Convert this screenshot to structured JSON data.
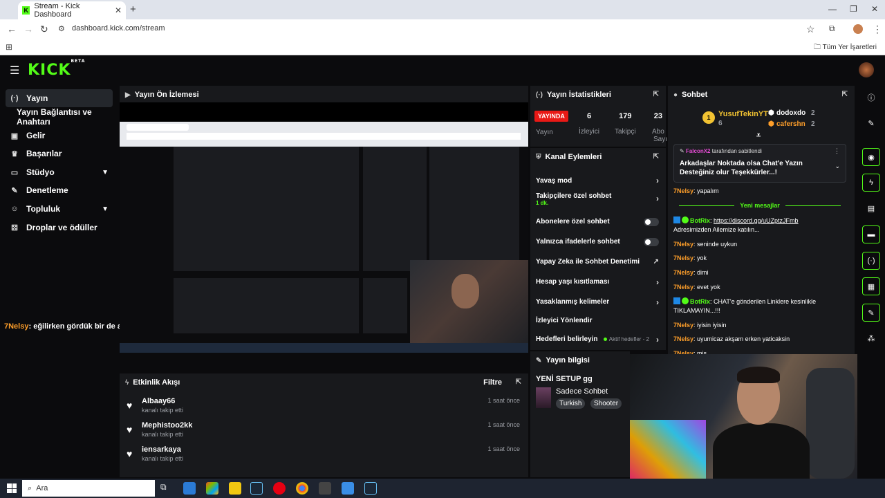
{
  "browser": {
    "tab_title": "Stream - Kick Dashboard",
    "url": "dashboard.kick.com/stream",
    "bookmarks_label": "Tüm Yer İşaretleri"
  },
  "kick": {
    "logo": "KICK",
    "beta": "BETA"
  },
  "sidebar": {
    "items": [
      {
        "label": "Yayın",
        "icon": "broadcast-icon"
      },
      {
        "label": "Yayın Bağlantısı ve Anahtarı"
      },
      {
        "label": "Gelir",
        "icon": "money-icon"
      },
      {
        "label": "Başarılar",
        "icon": "trophy-icon"
      },
      {
        "label": "Stüdyo",
        "icon": "monitor-icon"
      },
      {
        "label": "Denetleme",
        "icon": "wrench-icon"
      },
      {
        "label": "Topluluk",
        "icon": "people-icon"
      },
      {
        "label": "Droplar ve ödüller",
        "icon": "gift-icon"
      }
    ]
  },
  "overlay_chat": {
    "user": "7Nelsy",
    "text": ": eğilirken gördük bir de abo"
  },
  "preview": {
    "title": "Yayın Ön İzlemesi"
  },
  "events": {
    "title": "Etkinlik Akışı",
    "filter": "Filtre",
    "rows": [
      {
        "name": "Albaay66",
        "sub": "kanalı takip etti",
        "time": "1 saat önce"
      },
      {
        "name": "Mephistoo2kk",
        "sub": "kanalı takip etti",
        "time": "1 saat önce"
      },
      {
        "name": "iensarkaya",
        "sub": "kanalı takip etti",
        "time": "1 saat önce"
      }
    ]
  },
  "stats": {
    "title": "Yayın İstatistikleri",
    "live": "YAYINDA",
    "live_label": "Yayın",
    "items": [
      {
        "value": "6",
        "label": "İzleyici"
      },
      {
        "value": "179",
        "label": "Takipçi"
      },
      {
        "value": "23",
        "label": "Abo"
      }
    ],
    "overflow_label": "Sayı"
  },
  "actions": {
    "title": "Kanal Eylemleri",
    "slow": "Yavaş mod",
    "followers": "Takipçilere özel sohbet",
    "followers_sub": "1 dk.",
    "subs": "Abonelere özel sohbet",
    "emotes": "Yalnızca ifadelerle sohbet",
    "ai": "Yapay Zeka ile Sohbet Denetimi",
    "age": "Hesap yaşı kısıtlaması",
    "banned": "Yasaklanmış kelimeler",
    "redirect": "İzleyici Yönlendir",
    "goals": "Hedefleri belirleyin",
    "goals_status": "Aktif hedefler - 2"
  },
  "info": {
    "title": "Yayın bilgisi",
    "stream_title": "YENİ SETUP gg",
    "category": "Sadece Sohbet",
    "tags": [
      "Turkish",
      "Shooter"
    ]
  },
  "chat": {
    "title": "Sohbet",
    "gifters": [
      {
        "rank": "1",
        "name": "YusufTekinYT",
        "count": "6"
      },
      {
        "name": "dodoxdo",
        "count": "2"
      },
      {
        "name": "cafershn",
        "count": "2"
      }
    ],
    "pinned_by": "FalconX2",
    "pinned_suffix": "tarafından sabitlendi",
    "pinned_text": "Arkadaşlar Noktada olsa Chat'e Yazın Desteğiniz olur Teşekkürler...!",
    "new_messages": "Yeni mesajlar",
    "messages": [
      {
        "user": "7Nelsy",
        "text": "yapalım"
      },
      {
        "user": "BotRix",
        "bot": true,
        "link": "https://discord.gg/uUZptzJFmb",
        "text": "Adresimizden Ailemize katılın..."
      },
      {
        "user": "7Nelsy",
        "text": "seninde uykun"
      },
      {
        "user": "7Nelsy",
        "text": "yok"
      },
      {
        "user": "7Nelsy",
        "text": "dimi"
      },
      {
        "user": "7Nelsy",
        "text": "evet yok"
      },
      {
        "user": "BotRix",
        "bot": true,
        "text": "CHAT'e gönderilen Linklere kesinlikle TIKLAMAYIN...!!!"
      },
      {
        "user": "7Nelsy",
        "text": "iyisin iyisin"
      },
      {
        "user": "7Nelsy",
        "text": "uyumicaz akşam erken yaticaksin"
      },
      {
        "user": "7Nelsy",
        "text": "mis"
      }
    ]
  },
  "taskbar": {
    "search_placeholder": "Ara"
  },
  "colors": {
    "kick_green": "#53fc18",
    "live_red": "#e91916",
    "username_orange": "#ff9f2a"
  }
}
